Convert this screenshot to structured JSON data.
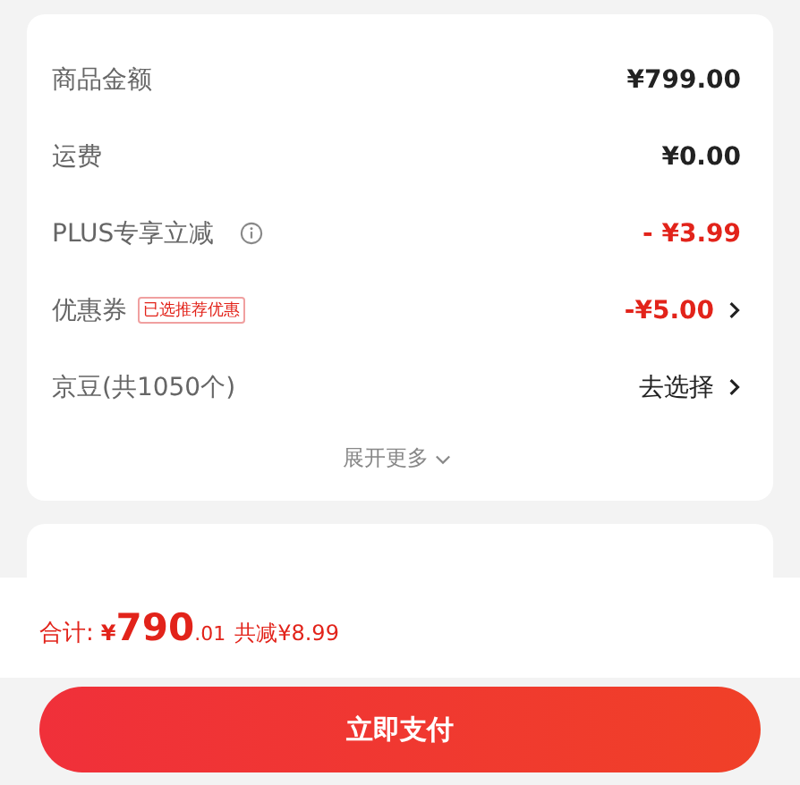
{
  "rows": [
    {
      "label": "商品金额",
      "value": "¥799.00",
      "kind": "amount",
      "info": false,
      "chevron": false
    },
    {
      "label": "运费",
      "value": "¥0.00",
      "kind": "amount",
      "info": false,
      "chevron": false
    },
    {
      "label": "PLUS专享立减",
      "value": "- ¥3.99",
      "kind": "discount",
      "info": true,
      "chevron": false
    },
    {
      "label": "优惠券",
      "badge": "已选推荐优惠",
      "value": "-¥5.00",
      "kind": "discount",
      "info": false,
      "chevron": true
    },
    {
      "label": "京豆(共1050个)",
      "value": "去选择",
      "kind": "action",
      "info": false,
      "chevron": true
    }
  ],
  "expand": "展开更多",
  "total": {
    "label": "合计:",
    "currency": "¥",
    "integer": "790",
    "decimal": ".01",
    "saved": "共减¥8.99"
  },
  "pay_button": "立即支付"
}
